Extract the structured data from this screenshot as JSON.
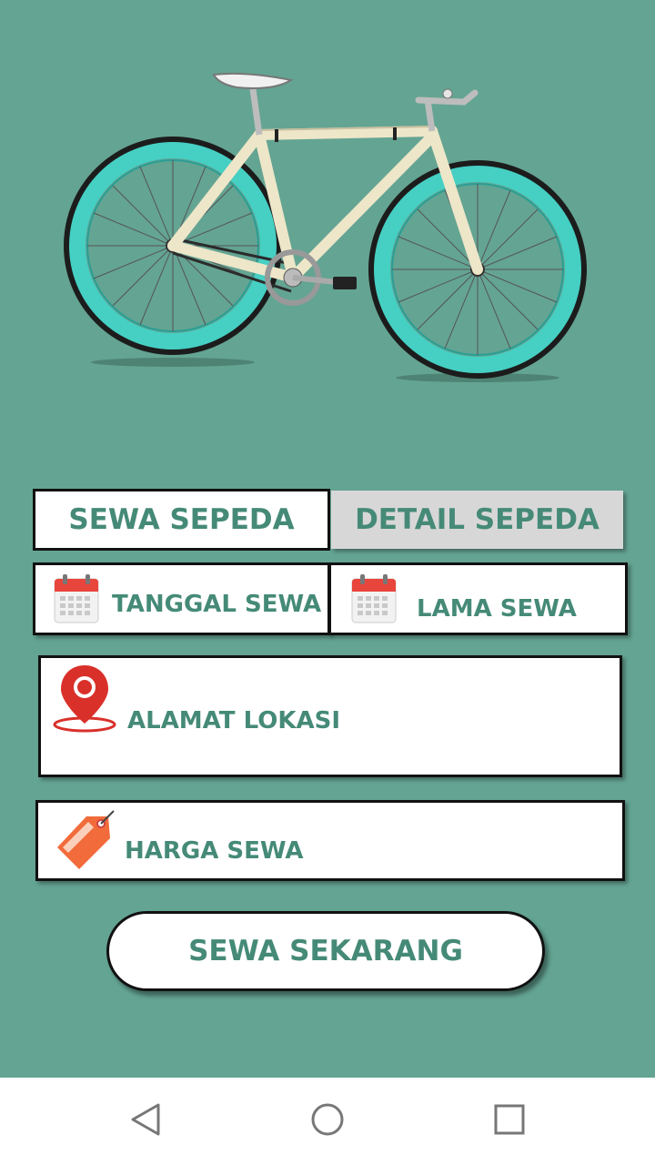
{
  "app": {
    "hero_image": "bicycle-image"
  },
  "tabs": [
    {
      "label": "SEWA SEPEDA",
      "active": true
    },
    {
      "label": "DETAIL SEPEDA",
      "active": false
    }
  ],
  "form": {
    "rent_date_label": "TANGGAL SEWA",
    "rent_duration_label": "LAMA SEWA",
    "address_label": "ALAMAT LOKASI",
    "price_label": "HARGA SEWA"
  },
  "actions": {
    "submit_label": "SEWA SEKARANG"
  },
  "navbar": {
    "icons": [
      "back-icon",
      "home-icon",
      "recents-icon"
    ]
  },
  "colors": {
    "background": "#64a492",
    "accent_text": "#458a77",
    "tire": "#45d0c4",
    "frame": "#ede6c9",
    "pin_red": "#d9302a",
    "tag_orange": "#f26b3a"
  }
}
